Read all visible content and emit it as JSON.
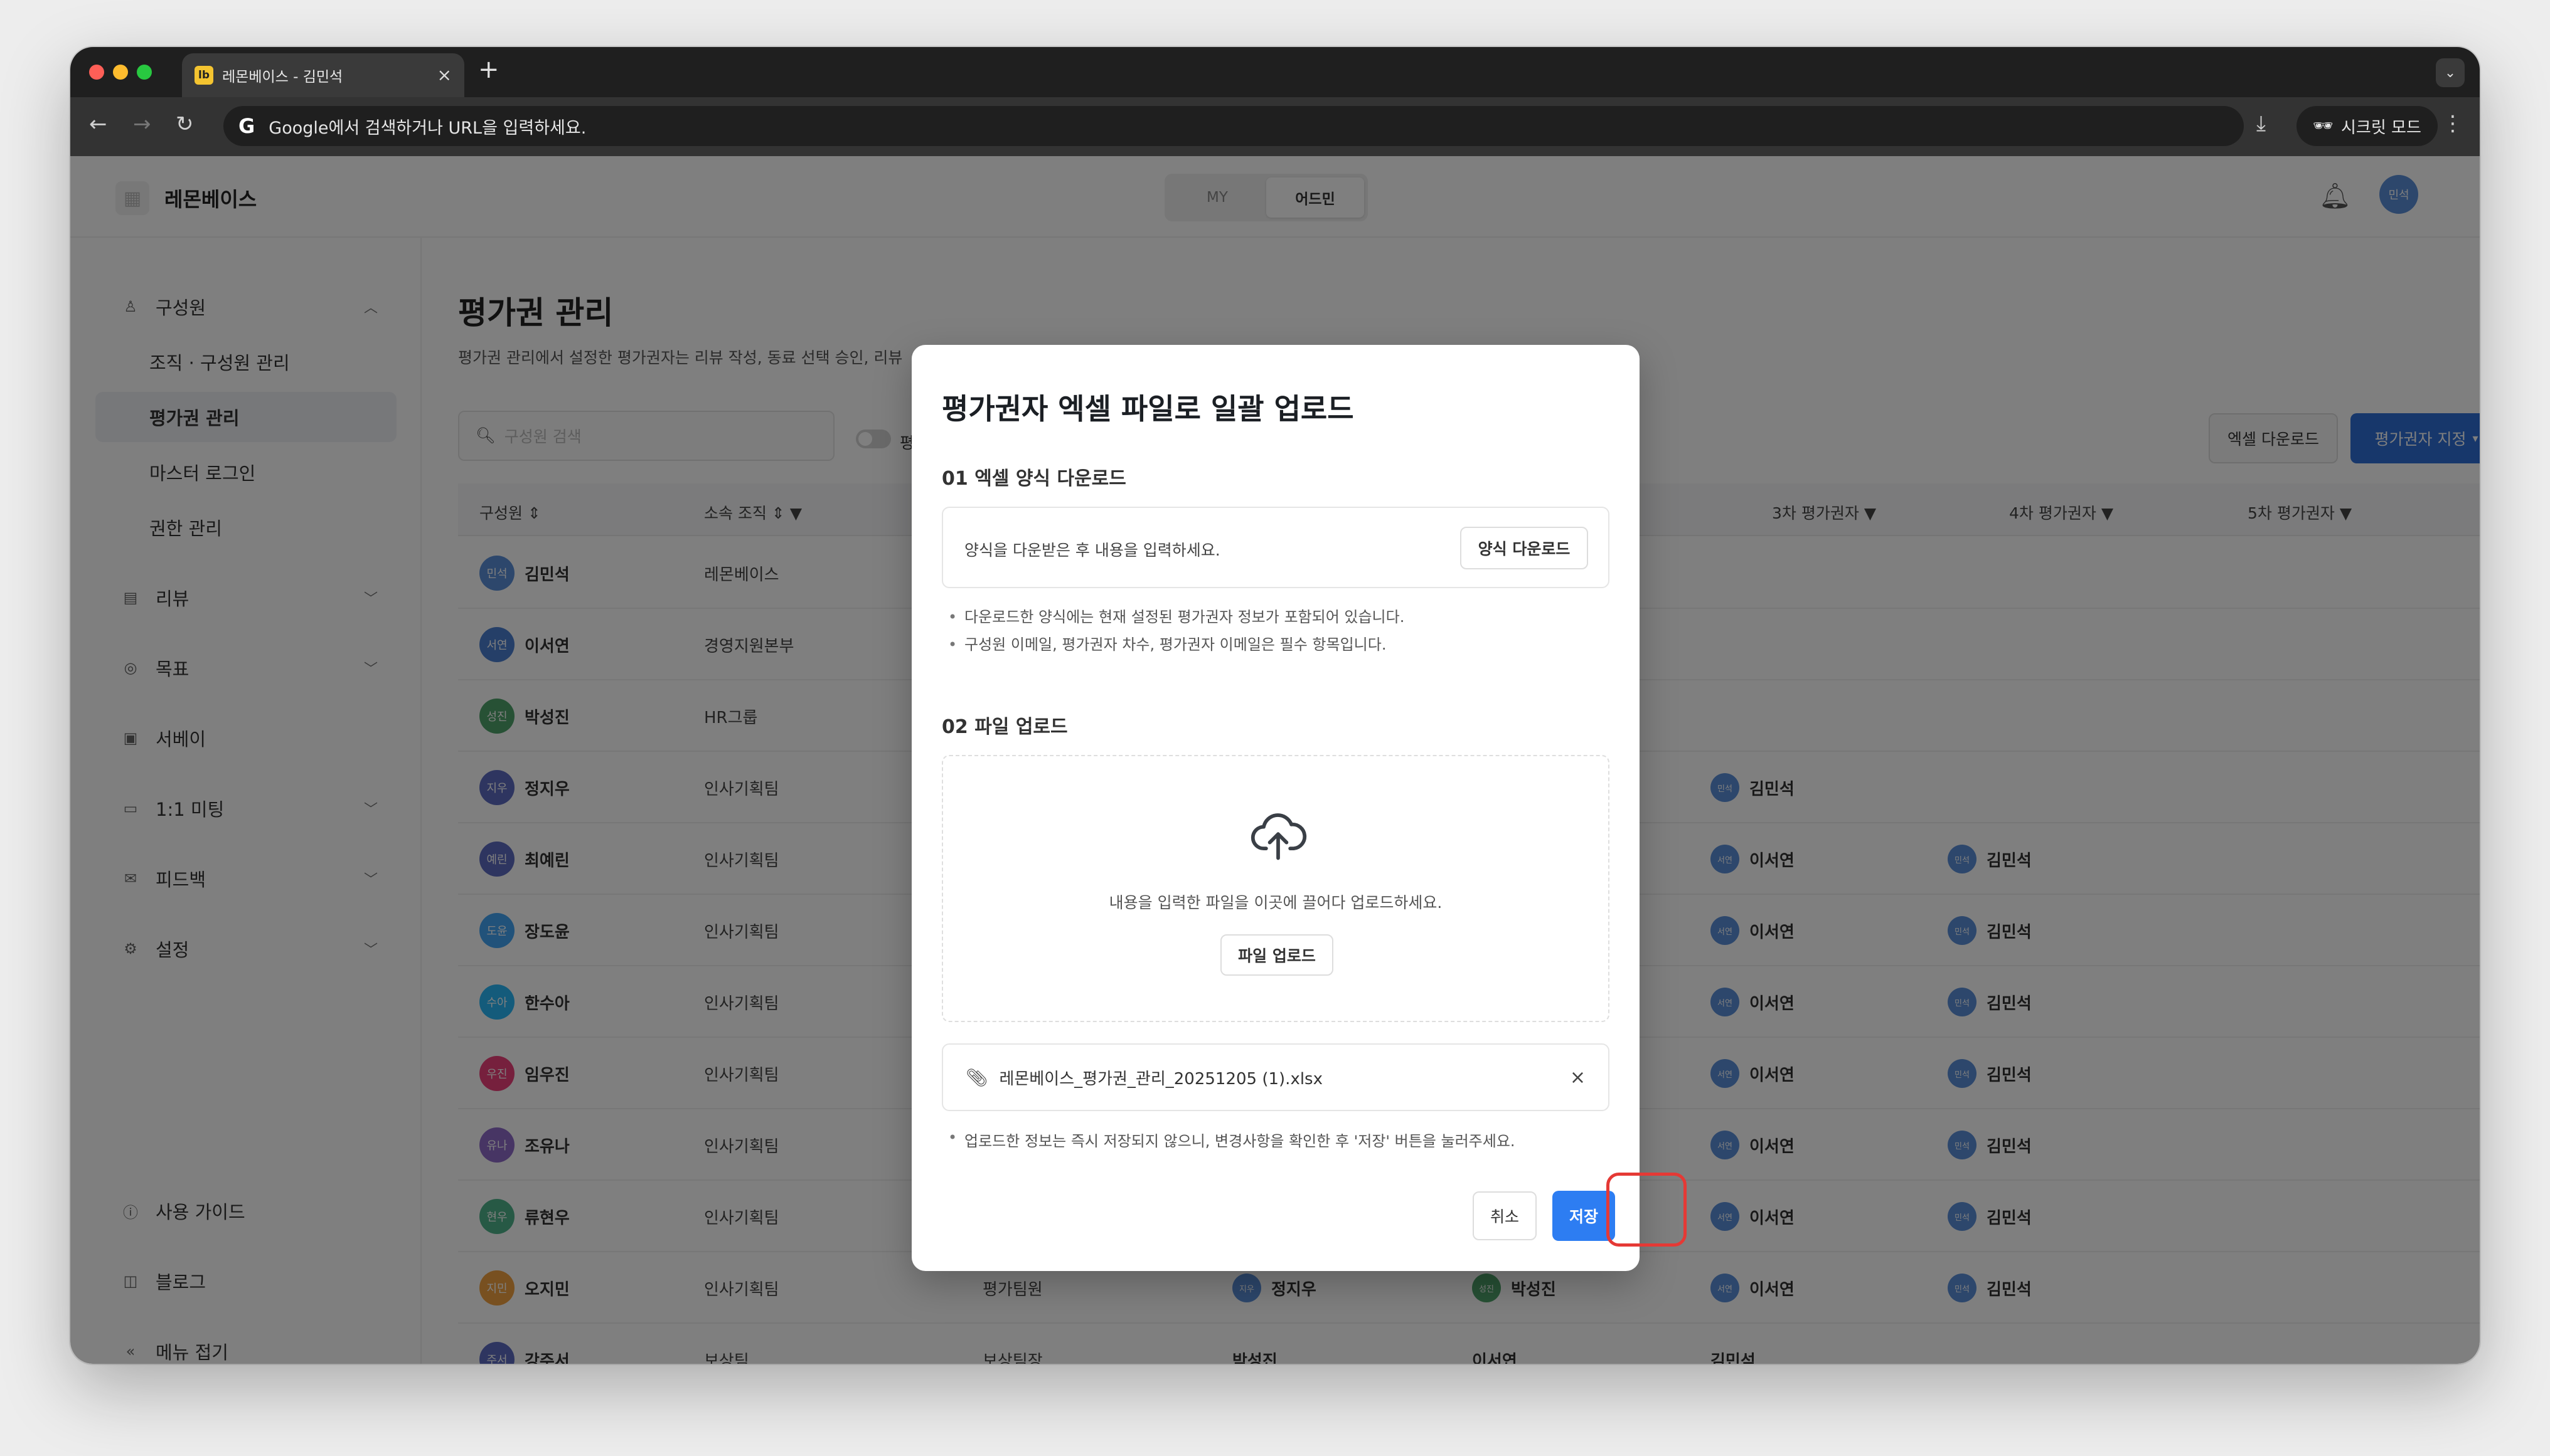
{
  "browser": {
    "tab_title": "레몬베이스 - 김민석",
    "tab_favicon": "lb",
    "omnibox_text": "Google에서 검색하거나 URL을 입력하세요.",
    "incognito_label": "시크릿 모드"
  },
  "header": {
    "brand": "레몬베이스",
    "mode_my": "MY",
    "mode_admin": "어드민",
    "avatar": "민석"
  },
  "sidebar": {
    "members": "구성원",
    "org_management": "조직 · 구성원 관리",
    "reviewer_management": "평가권 관리",
    "master_login": "마스터 로그인",
    "permission_management": "권한 관리",
    "review": "리뷰",
    "goal": "목표",
    "survey": "서베이",
    "meeting": "1:1 미팅",
    "feedback": "피드백",
    "settings": "설정",
    "guide": "사용 가이드",
    "blog": "블로그",
    "collapse": "메뉴 접기"
  },
  "main": {
    "title": "평가권 관리",
    "description": "평가권 관리에서 설정한 평가권자는 리뷰 작성, 동료 선택 승인, 리뷰",
    "search_placeholder": "구성원 검색",
    "toggle_label": "평",
    "excel_download": "엑셀 다운로드",
    "assign_reviewer": "평가권자 지정",
    "columns": {
      "member": "구성원",
      "org": "소속 조직",
      "r3": "3차 평가권자",
      "r4": "4차 평가권자",
      "r5": "5차 평가권자"
    },
    "rows": [
      {
        "avatar": "민석",
        "name": "김민석",
        "org": "레몬베이스",
        "color": "#5b8fd8"
      },
      {
        "avatar": "서연",
        "name": "이서연",
        "org": "경영지원본부",
        "color": "#4a7fd0"
      },
      {
        "avatar": "성진",
        "name": "박성진",
        "org": "HR그룹",
        "color": "#4fa36a"
      },
      {
        "avatar": "지우",
        "name": "정지우",
        "org": "인사기획팀",
        "color": "#5c6bc0",
        "r3_avatar": "민석",
        "r3": "김민석"
      },
      {
        "avatar": "예린",
        "name": "최예린",
        "org": "인사기획팀",
        "color": "#5c6bc0",
        "r3_avatar": "서연",
        "r3": "이서연",
        "r4_avatar": "민석",
        "r4": "김민석"
      },
      {
        "avatar": "도윤",
        "name": "장도윤",
        "org": "인사기획팀",
        "color": "#42a5f5",
        "r3_avatar": "서연",
        "r3": "이서연",
        "r4_avatar": "민석",
        "r4": "김민석"
      },
      {
        "avatar": "수아",
        "name": "한수아",
        "org": "인사기획팀",
        "color": "#29b6f6",
        "r3_avatar": "서연",
        "r3": "이서연",
        "r4_avatar": "민석",
        "r4": "김민석"
      },
      {
        "avatar": "우진",
        "name": "임우진",
        "org": "인사기획팀",
        "color": "#ec407a",
        "r3_avatar": "서연",
        "r3": "이서연",
        "r4_avatar": "민석",
        "r4": "김민석"
      },
      {
        "avatar": "유나",
        "name": "조유나",
        "org": "인사기획팀",
        "color": "#8e6bc9",
        "r3_avatar": "서연",
        "r3": "이서연",
        "r4_avatar": "민석",
        "r4": "김민석"
      },
      {
        "avatar": "현우",
        "name": "류현우",
        "org": "인사기획팀",
        "color": "#4fb38b",
        "r3_avatar": "서연",
        "r3": "이서연",
        "r4_avatar": "민석",
        "r4": "김민석"
      },
      {
        "avatar": "지민",
        "name": "오지민",
        "org": "인사기획팀",
        "color": "#f0a040",
        "col3": "평가팀원",
        "col4_avatar": "지우",
        "col4": "정지우",
        "col5_avatar": "성진",
        "col5": "박성진",
        "r3_avatar": "서연",
        "r3": "이서연",
        "r4_avatar": "민석",
        "r4": "김민석"
      },
      {
        "avatar": "주서",
        "name": "강주서",
        "org": "보상팀",
        "color": "#5c6bc0",
        "col3": "보상팀장",
        "col4": "박성진",
        "col5": "이서연",
        "r3": "김민석"
      }
    ]
  },
  "modal": {
    "title": "평가권자 엑셀 파일로 일괄 업로드",
    "step1": "01 엑셀 양식 다운로드",
    "step1_text": "양식을 다운받은 후 내용을 입력하세요.",
    "template_button": "양식 다운로드",
    "bullet1": "다운로드한 양식에는 현재 설정된 평가권자 정보가 포함되어 있습니다.",
    "bullet2": "구성원 이메일, 평가권자 차수, 평가권자 이메일은 필수 항목입니다.",
    "step2": "02 파일 업로드",
    "drop_text": "내용을 입력한 파일을 이곳에 끌어다 업로드하세요.",
    "file_button": "파일 업로드",
    "file_name": "레몬베이스_평가권_관리_20251205 (1).xlsx",
    "note": "업로드한 정보는 즉시 저장되지 않으니, 변경사항을 확인한 후 '저장' 버튼을 눌러주세요.",
    "cancel": "취소",
    "save": "저장"
  },
  "colors": {
    "primary": "#2d7df2",
    "highlight": "#e53935"
  }
}
